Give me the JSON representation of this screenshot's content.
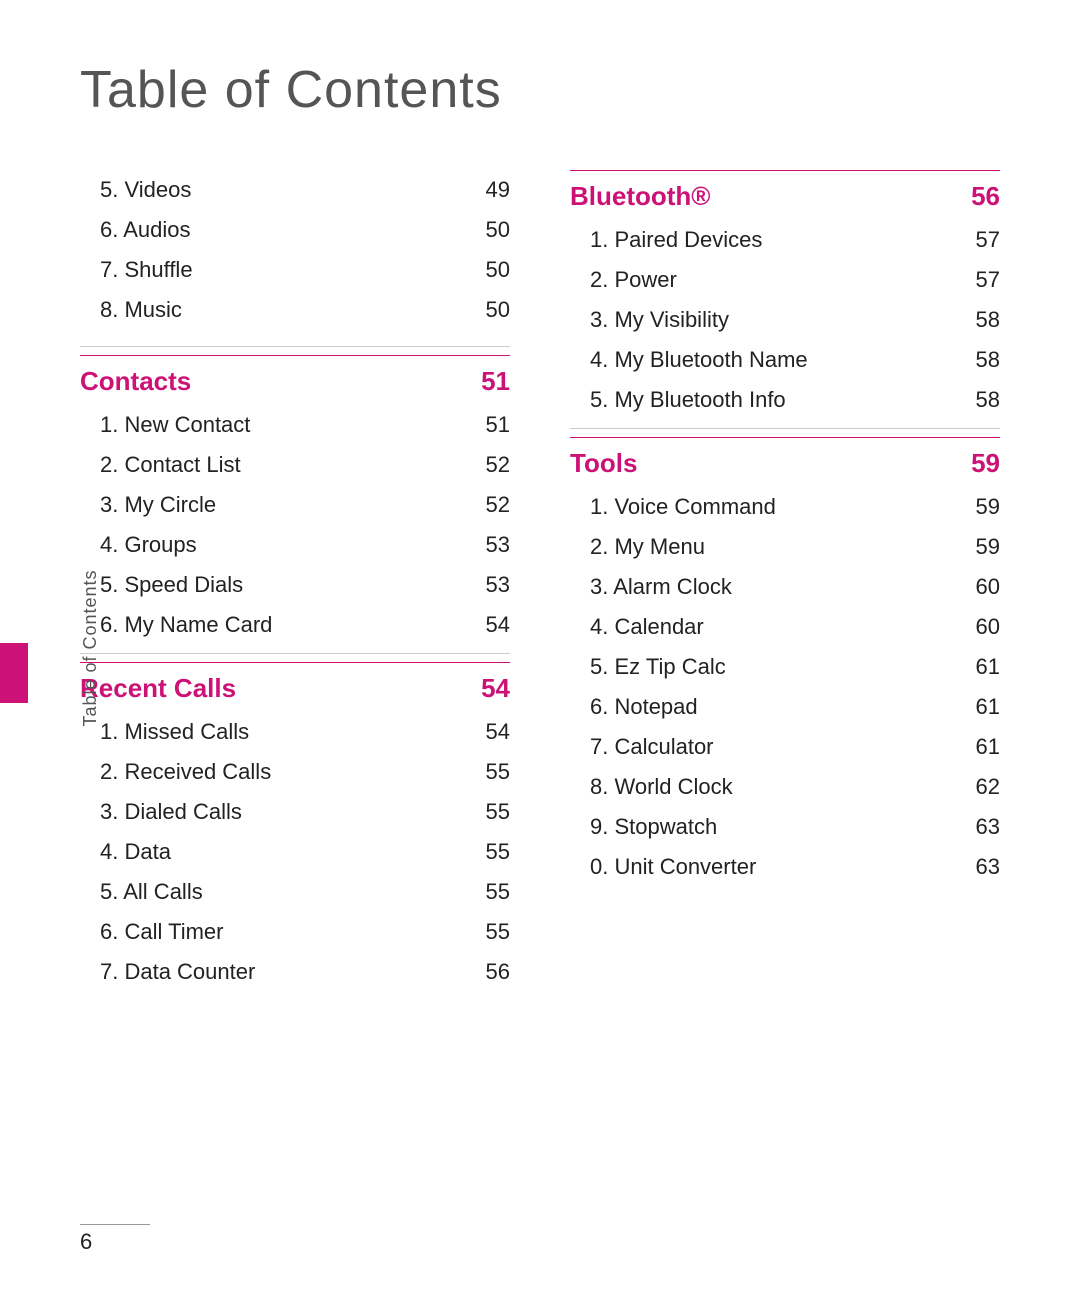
{
  "page": {
    "title": "Table of Contents",
    "number": "6",
    "sidebar_label": "Table of Contents"
  },
  "left_column": {
    "intro_items": [
      {
        "label": "5. Videos",
        "page": "49"
      },
      {
        "label": "6. Audios",
        "page": "50"
      },
      {
        "label": "7. Shuffle",
        "page": "50"
      },
      {
        "label": "8. Music",
        "page": "50"
      }
    ],
    "sections": [
      {
        "title": "Contacts",
        "page": "51",
        "items": [
          {
            "label": "1. New Contact",
            "page": "51"
          },
          {
            "label": "2. Contact List",
            "page": "52"
          },
          {
            "label": "3. My Circle",
            "page": "52"
          },
          {
            "label": "4. Groups",
            "page": "53"
          },
          {
            "label": "5. Speed Dials",
            "page": "53"
          },
          {
            "label": "6. My Name Card",
            "page": "54"
          }
        ]
      },
      {
        "title": "Recent Calls",
        "page": "54",
        "items": [
          {
            "label": "1. Missed Calls",
            "page": "54"
          },
          {
            "label": "2. Received Calls",
            "page": "55"
          },
          {
            "label": "3. Dialed Calls",
            "page": "55"
          },
          {
            "label": "4. Data",
            "page": "55"
          },
          {
            "label": "5. All Calls",
            "page": "55"
          },
          {
            "label": "6. Call Timer",
            "page": "55"
          },
          {
            "label": "7. Data Counter",
            "page": "56"
          }
        ]
      }
    ]
  },
  "right_column": {
    "sections": [
      {
        "title": "Bluetooth®",
        "page": "56",
        "items": [
          {
            "label": "1. Paired Devices",
            "page": "57"
          },
          {
            "label": "2. Power",
            "page": "57"
          },
          {
            "label": "3. My Visibility",
            "page": "58"
          },
          {
            "label": "4. My Bluetooth Name",
            "page": "58"
          },
          {
            "label": "5. My Bluetooth Info",
            "page": "58"
          }
        ]
      },
      {
        "title": "Tools",
        "page": "59",
        "items": [
          {
            "label": "1. Voice Command",
            "page": "59"
          },
          {
            "label": "2. My Menu",
            "page": "59"
          },
          {
            "label": "3. Alarm Clock",
            "page": "60"
          },
          {
            "label": "4. Calendar",
            "page": "60"
          },
          {
            "label": "5. Ez Tip Calc",
            "page": "61"
          },
          {
            "label": "6. Notepad",
            "page": "61"
          },
          {
            "label": "7. Calculator",
            "page": "61"
          },
          {
            "label": "8. World Clock",
            "page": "62"
          },
          {
            "label": "9. Stopwatch",
            "page": "63"
          },
          {
            "label": "0. Unit Converter",
            "page": "63"
          }
        ]
      }
    ]
  }
}
